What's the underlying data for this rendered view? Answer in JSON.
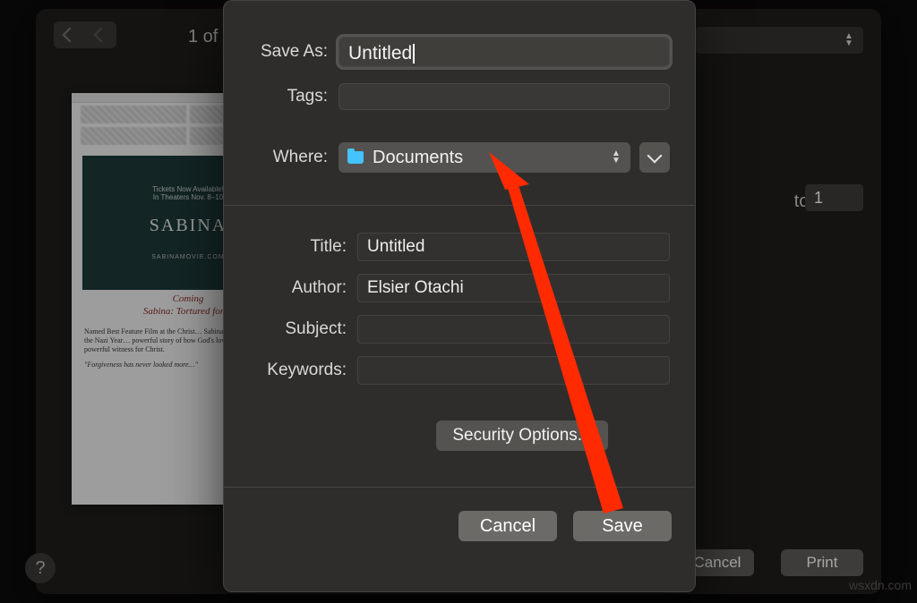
{
  "background": {
    "page_counter_prefix": "1 of",
    "to_label": "to:",
    "to_value": "1",
    "cancel": "Cancel",
    "print": "Print"
  },
  "sheet": {
    "save_as_label": "Save As:",
    "save_as_value": "Untitled",
    "tags_label": "Tags:",
    "where_label": "Where:",
    "where_value": "Documents",
    "title_label": "Title:",
    "title_value": "Untitled",
    "author_label": "Author:",
    "author_value": "Elsier Otachi",
    "subject_label": "Subject:",
    "subject_value": "",
    "keywords_label": "Keywords:",
    "keywords_value": "",
    "security_btn": "Security Options...",
    "cancel": "Cancel",
    "save": "Save"
  },
  "thumb": {
    "ticket_line": "Tickets Now Available!\nIn Theaters Nov. 8–10",
    "title": "SABINA",
    "site": "SABINAMOVIE.COM",
    "heading": "Coming\nSabina: Tortured for C",
    "para1": "Named Best Feature Film at the Christ… Sabina: Tortured for Christ, the Nazi Year… powerful story of how God's love transf… into a powerful witness for Christ.",
    "quote": "\"Forgiveness has never looked more…\""
  },
  "watermark": "wsxdn.com",
  "help": "?"
}
